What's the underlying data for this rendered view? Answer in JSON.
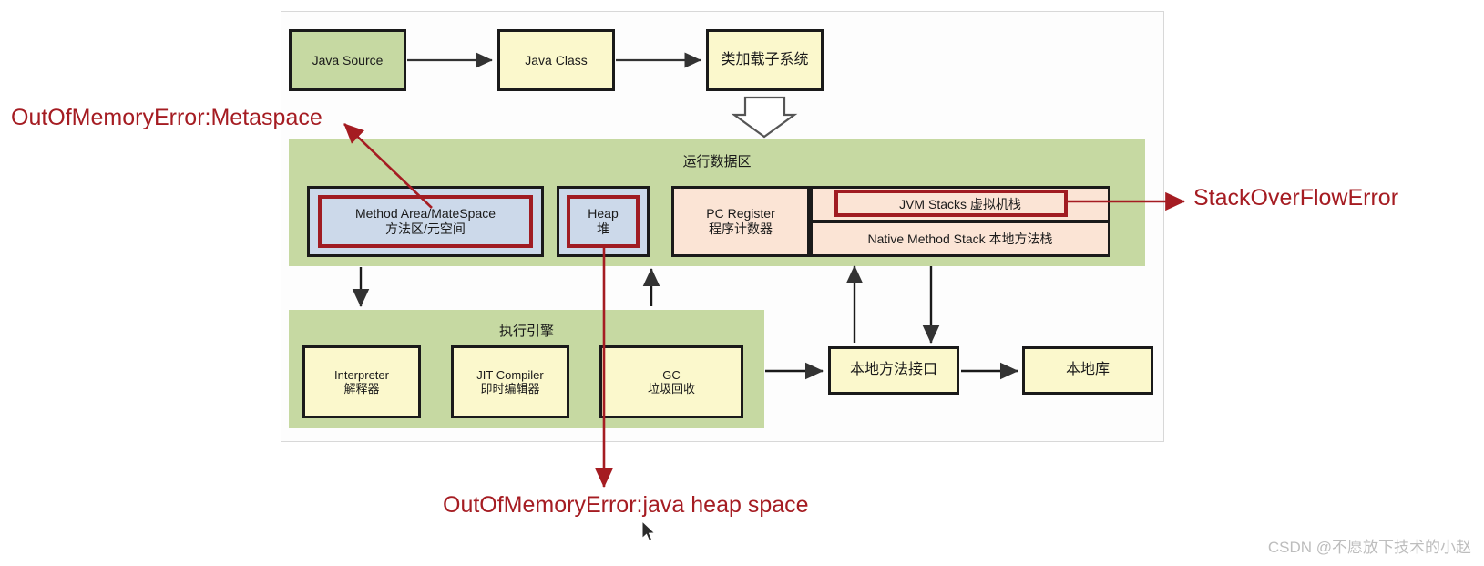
{
  "diagram": {
    "title_hidden": "JVM Architecture Diagram",
    "pipeline": [
      {
        "id": "java-source",
        "label": "Java Source",
        "label2": ""
      },
      {
        "id": "java-class",
        "label": "Java Class",
        "label2": ""
      },
      {
        "id": "class-loader",
        "label": "类加载子系统",
        "label2": ""
      }
    ],
    "runtime_area": {
      "title": "运行数据区",
      "method_area": {
        "l1": "Method Area/MateSpace",
        "l2": "方法区/元空间"
      },
      "heap": {
        "l1": "Heap",
        "l2": "堆"
      },
      "pc_register": {
        "l1": "PC Register",
        "l2": "程序计数器"
      },
      "jvm_stacks": {
        "l1": "JVM Stacks 虚拟机栈",
        "l2": ""
      },
      "native_method_stack": {
        "l1": "Native Method Stack 本地方法栈",
        "l2": ""
      }
    },
    "execution_engine": {
      "title": "执行引擎",
      "interpreter": {
        "l1": "Interpreter",
        "l2": "解释器"
      },
      "jit_compiler": {
        "l1": "JIT Compiler",
        "l2": "即时编辑器"
      },
      "gc": {
        "l1": "GC",
        "l2": "垃圾回收"
      }
    },
    "native_interface": {
      "l1": "本地方法接口",
      "l2": ""
    },
    "native_library": {
      "l1": "本地库",
      "l2": ""
    },
    "annotations": {
      "metaspace_error": "OutOfMemoryError:Metaspace",
      "stackoverflow_error": "StackOverFlowError",
      "heap_error": "OutOfMemoryError:java heap space"
    },
    "watermark": "CSDN @不愿放下技术的小赵",
    "colors": {
      "green": "#c6d9a2",
      "yellow": "#fbf8cc",
      "blue": "#ccd9ea",
      "peach": "#fbe4d5",
      "annotation_red": "#a51c22",
      "frame_red": "#a01c22",
      "outline": "#1a1a1a"
    }
  }
}
